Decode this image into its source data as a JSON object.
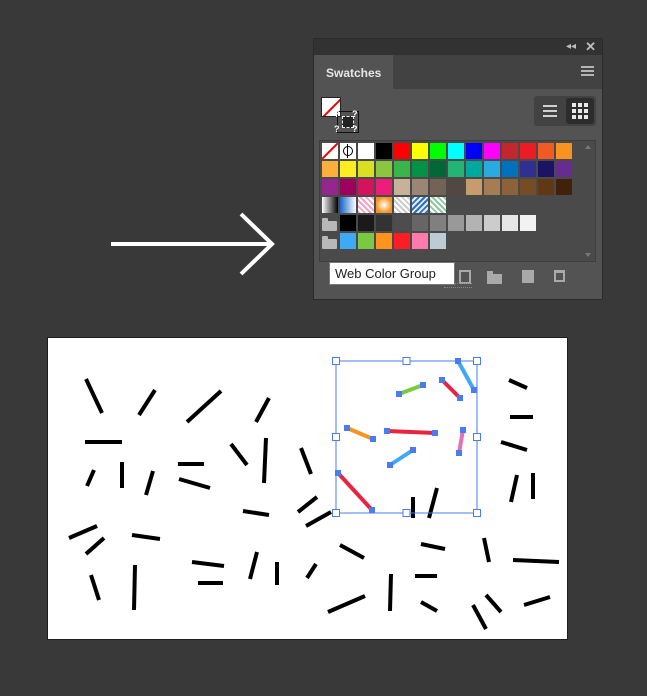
{
  "panel": {
    "title_tab": "Swatches",
    "tooltip": "Web Color Group"
  },
  "swatch_rows": [
    {
      "type": "special",
      "colors": [
        "none",
        "registration",
        "#ffffff",
        "#000000",
        "#ff0000",
        "#ffff00",
        "#00ff00",
        "#00ffff",
        "#0000ff",
        "#ff00ff",
        "#c1272d",
        "#ed1c24",
        "#f15a24",
        "#f7931e"
      ]
    },
    {
      "type": "colors",
      "colors": [
        "#fbb03b",
        "#fcee21",
        "#d9e021",
        "#8cc63f",
        "#39b54a",
        "#009245",
        "#006837",
        "#22b573",
        "#00a99d",
        "#29abe2",
        "#0071bc",
        "#2e3192",
        "#1b1464",
        "#662d91"
      ]
    },
    {
      "type": "colors",
      "colors": [
        "#93278f",
        "#9e005d",
        "#d4145a",
        "#ed1e79",
        "#c7b299",
        "#998675",
        "#736357",
        "#534741",
        "#c69c6d",
        "#a67c52",
        "#8c6239",
        "#754c24",
        "#603813",
        "#42210b"
      ]
    },
    {
      "type": "patterns",
      "colors": [
        "gradient-bw",
        "gradient-blue",
        "pattern-pink",
        "gradient-orange",
        "pattern-check",
        "pattern-blue",
        "pattern-green"
      ]
    },
    {
      "type": "group-gray",
      "colors": [
        "#000000",
        "#1a1a1a",
        "#333333",
        "#4d4d4d",
        "#666666",
        "#808080",
        "#999999",
        "#b3b3b3",
        "#cccccc",
        "#e6e6e6",
        "#f2f2f2"
      ]
    },
    {
      "type": "group-web",
      "colors": [
        "#3fa9f5",
        "#7ac943",
        "#ff931e",
        "#ff1d25",
        "#ff7bac",
        "#bdccd4"
      ]
    }
  ],
  "canvas_strokes_black": [
    [
      85,
      378,
      101,
      412
    ],
    [
      138,
      414,
      154,
      389
    ],
    [
      186,
      421,
      220,
      390
    ],
    [
      255,
      421,
      268,
      397
    ],
    [
      84,
      441,
      121,
      441
    ],
    [
      86,
      485,
      93,
      469
    ],
    [
      121,
      461,
      121,
      487
    ],
    [
      145,
      494,
      152,
      470
    ],
    [
      177,
      463,
      203,
      463
    ],
    [
      178,
      478,
      209,
      487
    ],
    [
      230,
      443,
      246,
      464
    ],
    [
      265,
      437,
      263,
      482
    ],
    [
      300,
      447,
      310,
      473
    ],
    [
      242,
      510,
      268,
      514
    ],
    [
      297,
      511,
      316,
      496
    ],
    [
      305,
      525,
      330,
      511
    ],
    [
      68,
      537,
      96,
      525
    ],
    [
      85,
      553,
      103,
      537
    ],
    [
      131,
      534,
      159,
      538
    ],
    [
      90,
      574,
      98,
      599
    ],
    [
      134,
      564,
      133,
      609
    ],
    [
      191,
      561,
      223,
      565
    ],
    [
      197,
      582,
      222,
      582
    ],
    [
      256,
      551,
      249,
      578
    ],
    [
      276,
      561,
      276,
      584
    ],
    [
      306,
      577,
      315,
      563
    ],
    [
      339,
      544,
      363,
      557
    ],
    [
      327,
      611,
      364,
      595
    ],
    [
      390,
      573,
      389,
      610
    ],
    [
      412,
      496,
      412,
      517
    ],
    [
      428,
      517,
      436,
      487
    ],
    [
      420,
      543,
      444,
      548
    ],
    [
      414,
      575,
      436,
      575
    ],
    [
      420,
      601,
      436,
      610
    ],
    [
      483,
      537,
      488,
      561
    ],
    [
      512,
      559,
      558,
      561
    ],
    [
      472,
      604,
      485,
      628
    ],
    [
      485,
      594,
      500,
      611
    ],
    [
      523,
      604,
      549,
      596
    ],
    [
      508,
      379,
      526,
      387
    ],
    [
      509,
      416,
      532,
      416
    ],
    [
      500,
      441,
      526,
      449
    ],
    [
      510,
      501,
      516,
      474
    ],
    [
      532,
      472,
      532,
      498
    ]
  ],
  "canvas_strokes_colored": [
    {
      "pts": [
        398,
        393,
        422,
        384
      ],
      "color": "#7ac943"
    },
    {
      "pts": [
        441,
        379,
        459,
        397
      ],
      "color": "#e8243f"
    },
    {
      "pts": [
        457,
        360,
        473,
        389
      ],
      "color": "#3fa9f5"
    },
    {
      "pts": [
        346,
        427,
        372,
        438
      ],
      "color": "#f7931e"
    },
    {
      "pts": [
        386,
        430,
        434,
        432
      ],
      "color": "#e8243f"
    },
    {
      "pts": [
        458,
        452,
        462,
        429
      ],
      "color": "#e86fb5"
    },
    {
      "pts": [
        389,
        464,
        412,
        449
      ],
      "color": "#3fa9f5"
    },
    {
      "pts": [
        337,
        472,
        371,
        509
      ],
      "color": "#e8243f"
    }
  ]
}
